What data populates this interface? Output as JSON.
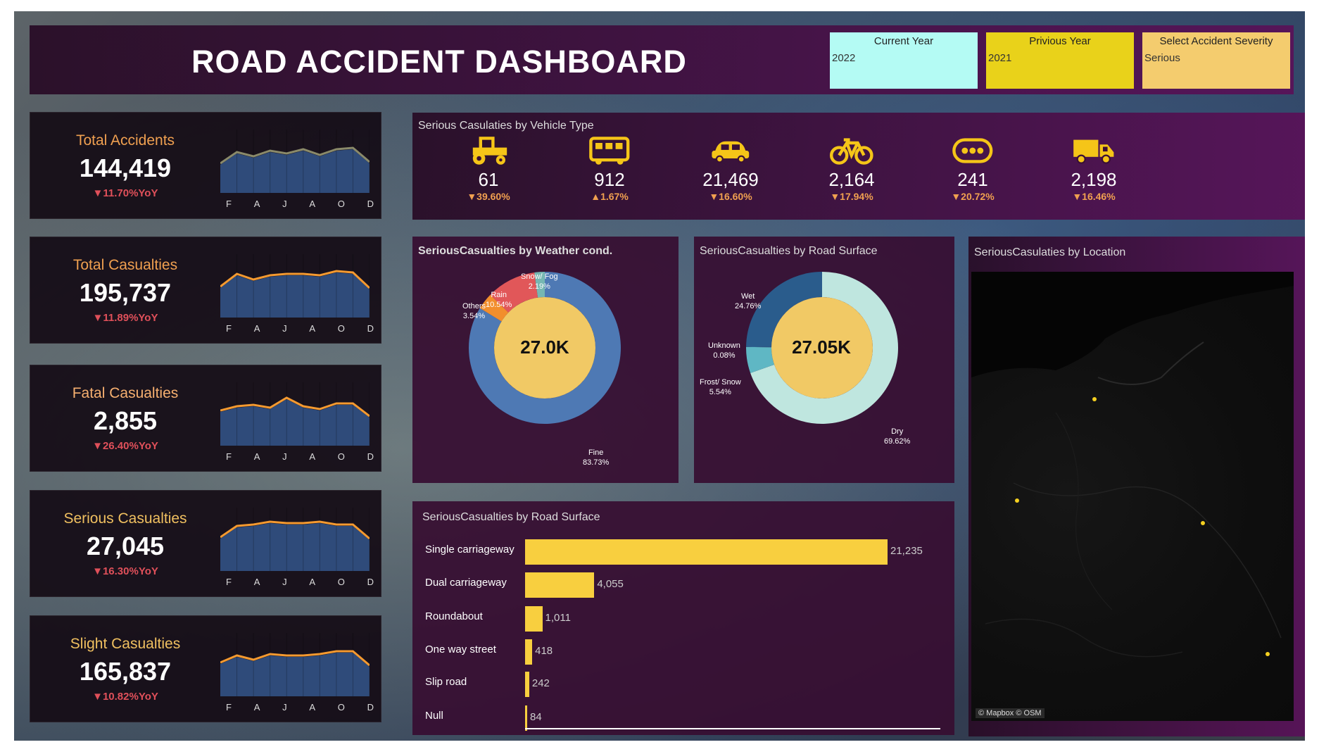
{
  "header": {
    "title": "ROAD ACCIDENT DASHBOARD",
    "filters": [
      {
        "label": "Current Year",
        "value": "2022",
        "color": "#b4fbf4"
      },
      {
        "label": "Privious Year",
        "value": "2021",
        "color": "#e9d21a"
      },
      {
        "label": "Select Accident Severity",
        "value": "Serious",
        "color": "#f4cc6e"
      }
    ]
  },
  "months": [
    "F",
    "A",
    "J",
    "A",
    "O",
    "D"
  ],
  "kpis": [
    {
      "label": "Total Accidents",
      "value": "144,419",
      "yoy": "▼11.70%YoY",
      "label_color": "#f0a050",
      "line_color": "#8a8a6a"
    },
    {
      "label": "Total Casualties",
      "value": "195,737",
      "yoy": "▼11.89%YoY",
      "label_color": "#f0a050",
      "line_color": "#f59a30"
    },
    {
      "label": "Fatal Casualties",
      "value": "2,855",
      "yoy": "▼26.40%YoY",
      "label_color": "#f7b070",
      "line_color": "#f59a30"
    },
    {
      "label": "Serious Casualties",
      "value": "27,045",
      "yoy": "▼16.30%YoY",
      "label_color": "#f0c060",
      "line_color": "#f59a30"
    },
    {
      "label": "Slight Casualties",
      "value": "165,837",
      "yoy": "▼10.82%YoY",
      "label_color": "#f0c060",
      "line_color": "#f59a30"
    }
  ],
  "vehicle": {
    "title": "Serious Casulaties by Vehicle Type",
    "items": [
      {
        "icon": "tractor-icon",
        "value": "61",
        "yoy": "▼39.60%"
      },
      {
        "icon": "bus-icon",
        "value": "912",
        "yoy": "▲1.67%"
      },
      {
        "icon": "car-icon",
        "value": "21,469",
        "yoy": "▼16.60%"
      },
      {
        "icon": "bicycle-icon",
        "value": "2,164",
        "yoy": "▼17.94%"
      },
      {
        "icon": "other-vehicle-icon",
        "value": "241",
        "yoy": "▼20.72%"
      },
      {
        "icon": "van-icon",
        "value": "2,198",
        "yoy": "▼16.46%"
      }
    ]
  },
  "weather": {
    "title": "SeriousCasualties by Weather cond.",
    "center": "27.0K",
    "segments": [
      {
        "name": "Fine",
        "pct": "83.73%",
        "value": 83.73,
        "color": "#4e79b4"
      },
      {
        "name": "Others",
        "pct": "3.54%",
        "value": 3.54,
        "color": "#f28e2c"
      },
      {
        "name": "Rain",
        "pct": "10.54%",
        "value": 10.54,
        "color": "#e15759"
      },
      {
        "name": "Snow/ Fog",
        "pct": "2.19%",
        "value": 2.19,
        "color": "#76b7b2"
      }
    ]
  },
  "surface": {
    "title": "SeriousCasualties by Road Surface",
    "center": "27.05K",
    "segments": [
      {
        "name": "Dry",
        "pct": "69.62%",
        "value": 69.62,
        "color": "#bfe6df"
      },
      {
        "name": "Frost/ Snow",
        "pct": "5.54%",
        "value": 5.54,
        "color": "#5fb7c4"
      },
      {
        "name": "Unknown",
        "pct": "0.08%",
        "value": 0.08,
        "color": "#3a7aa0"
      },
      {
        "name": "Wet",
        "pct": "24.76%",
        "value": 24.76,
        "color": "#2a5c8c"
      }
    ]
  },
  "bars": {
    "title": "SeriousCasualties by Road Surface",
    "items": [
      {
        "label": "Single carriageway",
        "value": 21235,
        "display": "21,235"
      },
      {
        "label": "Dual carriageway",
        "value": 4055,
        "display": "4,055"
      },
      {
        "label": "Roundabout",
        "value": 1011,
        "display": "1,011"
      },
      {
        "label": "One way street",
        "value": 418,
        "display": "418"
      },
      {
        "label": "Slip road",
        "value": 242,
        "display": "242"
      },
      {
        "label": "Null",
        "value": 84,
        "display": "84"
      }
    ]
  },
  "map": {
    "title": "SeriousCasulaties by Location",
    "attribution": "© Mapbox © OSM"
  },
  "chart_data": [
    {
      "type": "pie",
      "title": "SeriousCasualties by Weather cond.",
      "categories": [
        "Fine",
        "Others",
        "Rain",
        "Snow/ Fog"
      ],
      "values": [
        83.73,
        3.54,
        10.54,
        2.19
      ]
    },
    {
      "type": "pie",
      "title": "SeriousCasualties by Road Surface",
      "categories": [
        "Dry",
        "Frost/ Snow",
        "Unknown",
        "Wet"
      ],
      "values": [
        69.62,
        5.54,
        0.08,
        24.76
      ]
    },
    {
      "type": "bar",
      "title": "SeriousCasualties by Road Surface",
      "categories": [
        "Single carriageway",
        "Dual carriageway",
        "Roundabout",
        "One way street",
        "Slip road",
        "Null"
      ],
      "values": [
        21235,
        4055,
        1011,
        418,
        242,
        84
      ]
    }
  ]
}
